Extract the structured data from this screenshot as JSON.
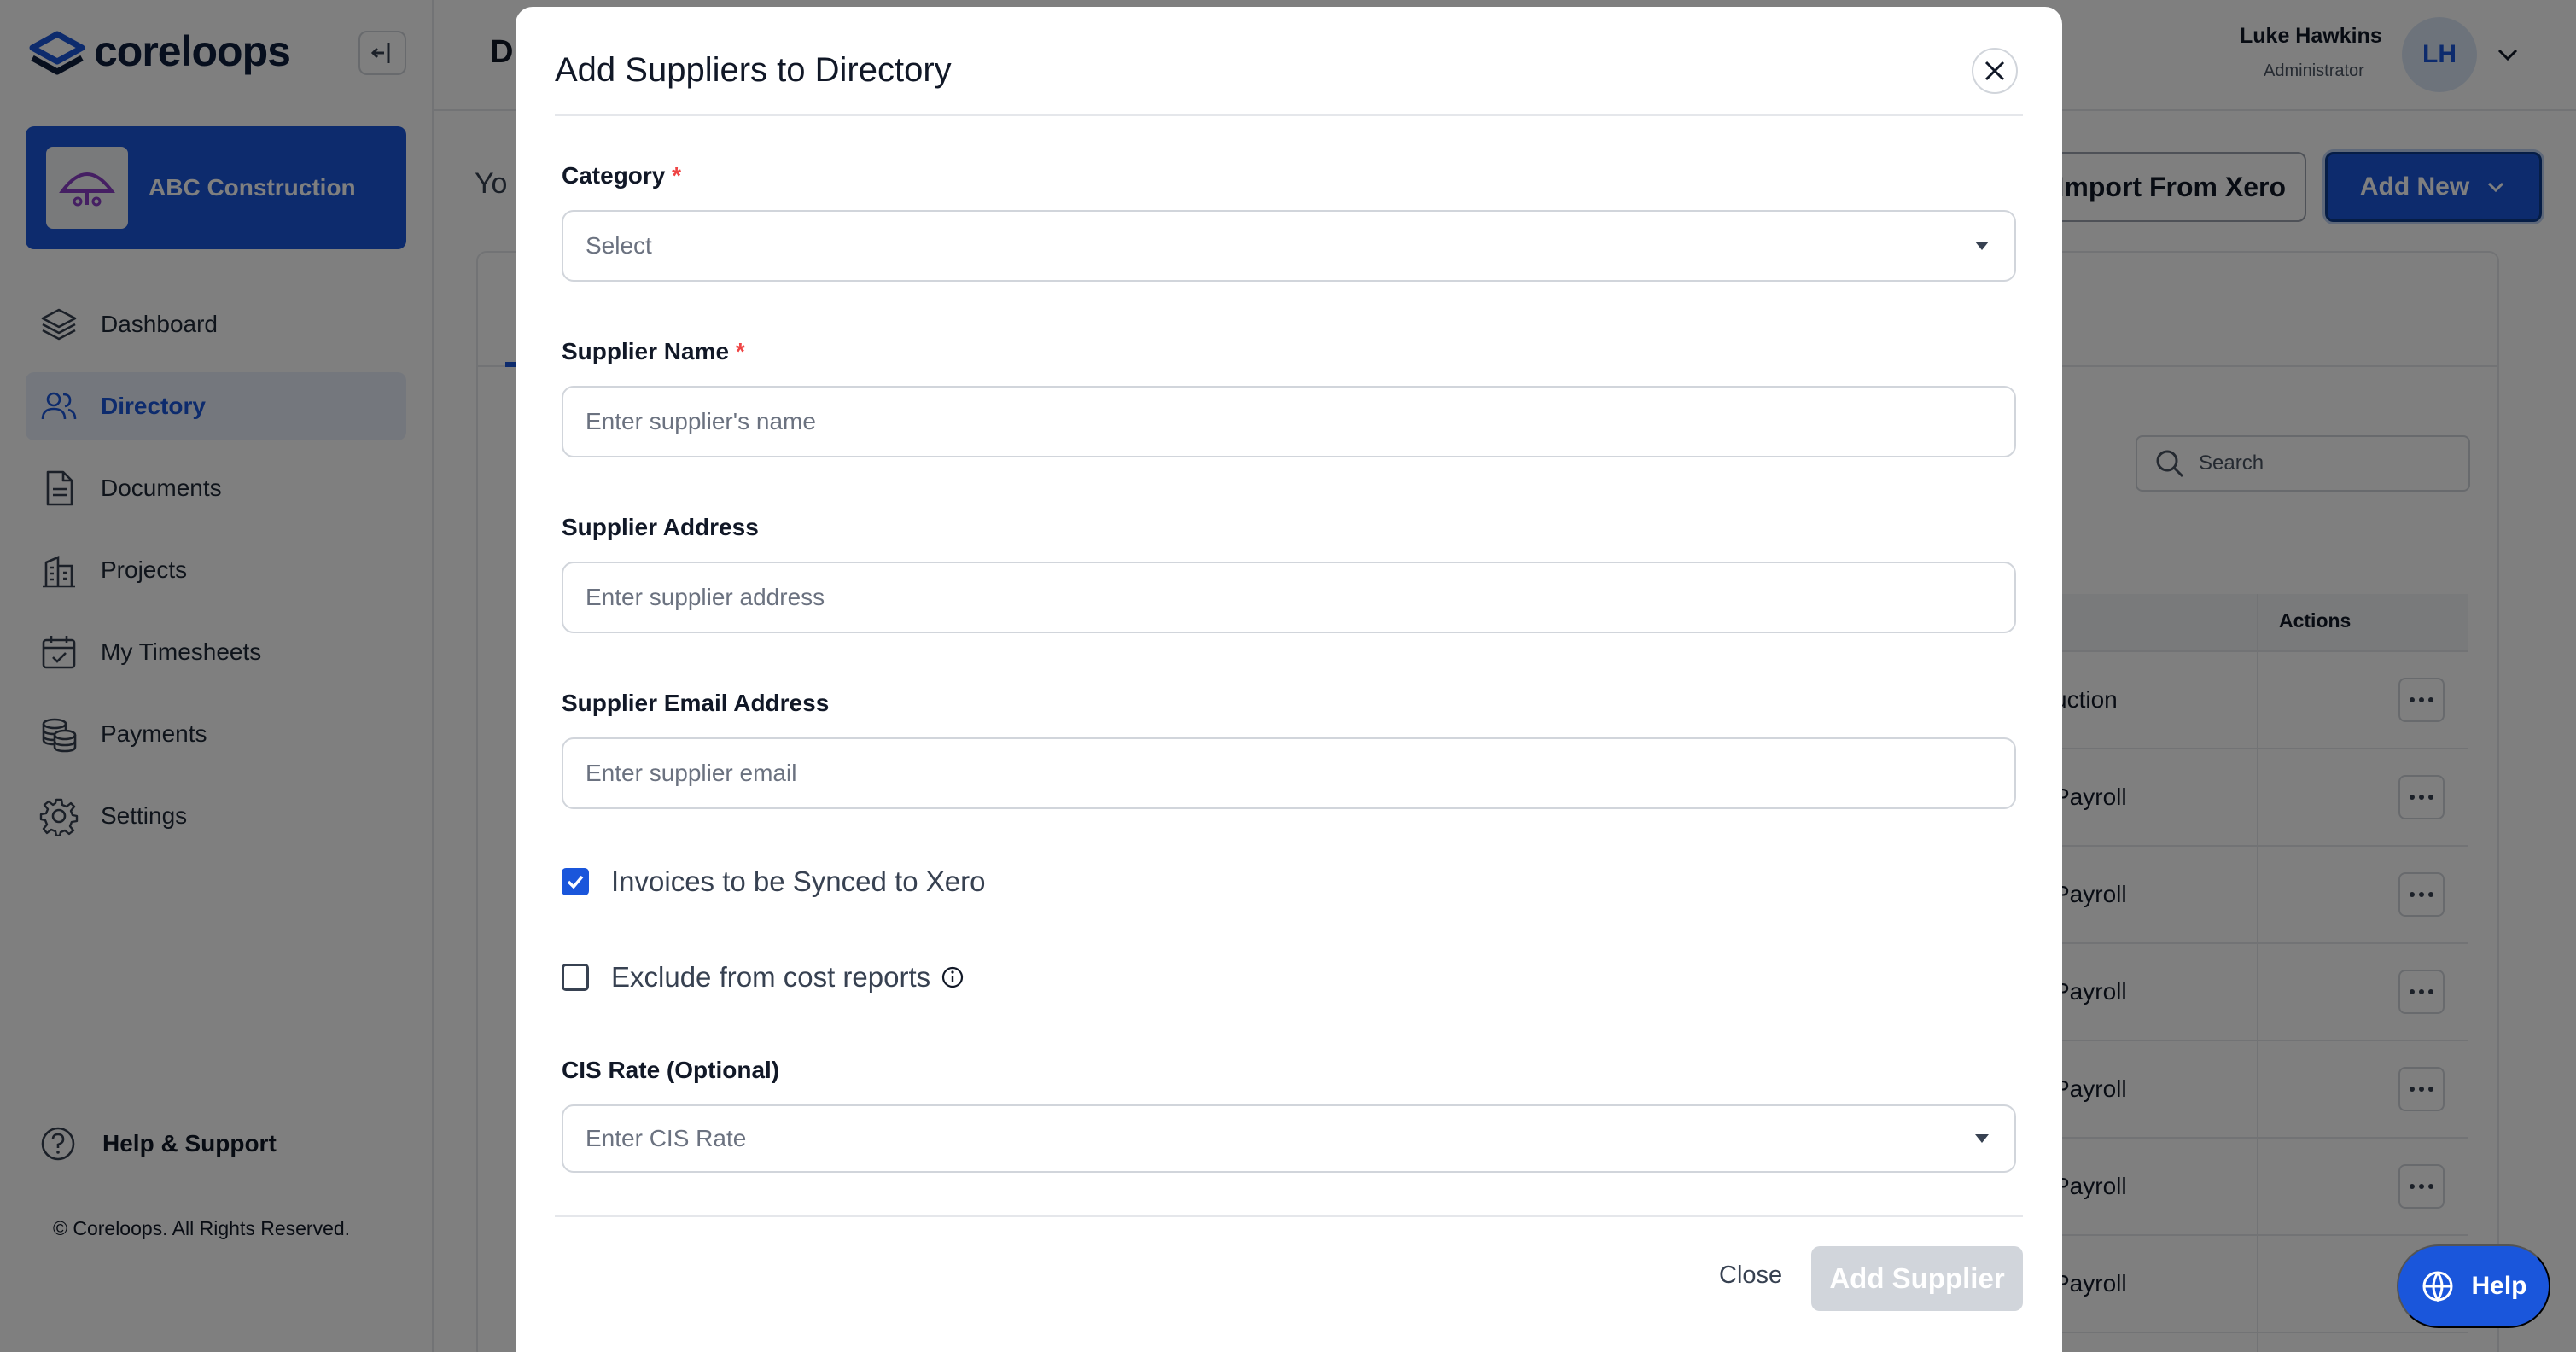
{
  "brand": {
    "name": "coreloops",
    "color": "#1a56db"
  },
  "sidebar": {
    "company": "ABC Construction",
    "items": [
      {
        "label": "Dashboard",
        "icon": "layers-icon"
      },
      {
        "label": "Directory",
        "icon": "users-icon",
        "active": true
      },
      {
        "label": "Documents",
        "icon": "document-icon"
      },
      {
        "label": "Projects",
        "icon": "building-icon"
      },
      {
        "label": "My Timesheets",
        "icon": "calendar-check-icon"
      },
      {
        "label": "Payments",
        "icon": "coins-icon"
      },
      {
        "label": "Settings",
        "icon": "gear-icon"
      }
    ],
    "help": "Help & Support",
    "copyright": "© Coreloops. All Rights Reserved."
  },
  "header": {
    "title": "D",
    "user_name": "Luke Hawkins",
    "user_role": "Administrator",
    "user_initials": "LH"
  },
  "page": {
    "subtitle": "Yo",
    "import_button": "Import From Xero",
    "add_new_button": "Add New",
    "search_placeholder": "Search",
    "actions_header": "Actions",
    "rows": [
      "uction",
      "Payroll",
      "Payroll",
      "Payroll",
      "Payroll",
      "Payroll",
      "Payroll"
    ]
  },
  "help_fab": "Help",
  "modal": {
    "title": "Add Suppliers to Directory",
    "category_label": "Category",
    "category_placeholder": "Select",
    "supplier_name_label": "Supplier Name",
    "supplier_name_placeholder": "Enter supplier's name",
    "supplier_address_label": "Supplier Address",
    "supplier_address_placeholder": "Enter supplier address",
    "supplier_email_label": "Supplier Email Address",
    "supplier_email_placeholder": "Enter supplier email",
    "sync_xero_label": "Invoices to be Synced to Xero",
    "sync_xero_checked": true,
    "exclude_cost_label": "Exclude from cost reports",
    "exclude_cost_checked": false,
    "cis_label": "CIS Rate (Optional)",
    "cis_placeholder": "Enter CIS Rate",
    "close_button": "Close",
    "add_button": "Add Supplier"
  }
}
